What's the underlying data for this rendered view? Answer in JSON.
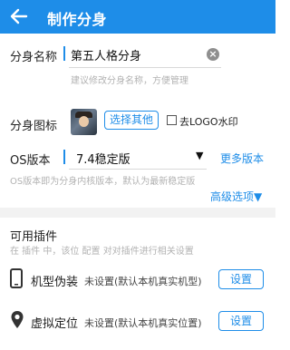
{
  "header": {
    "title": "制作分身"
  },
  "name_section": {
    "label": "分身名称",
    "value": "第五人格分身",
    "hint": "建议修改分身名称，方便管理"
  },
  "icon_section": {
    "label": "分身图标",
    "choose_label": "选择其他",
    "remove_logo_label": "去LOGO水印"
  },
  "os_section": {
    "label": "OS版本",
    "value": "7.4稳定版",
    "more_label": "更多版本",
    "hint": "OS版本即为分身内核版本，默认为最新稳定版",
    "advanced_label": "高级选项▼"
  },
  "plugins": {
    "title": "可用插件",
    "hint": "在 插件 中，该位 配置 对对插件进行相关设置",
    "items": [
      {
        "name": "机型伪装",
        "status": "未设置(默认本机真实机型)",
        "button": "设置",
        "icon": "phone-icon"
      },
      {
        "name": "虚拟定位",
        "status": "未设置(默认本机真实位置)",
        "button": "设置",
        "icon": "location-pin-icon"
      }
    ]
  },
  "colors": {
    "accent": "#1e8de8",
    "hint_text": "#b2b2b2"
  }
}
